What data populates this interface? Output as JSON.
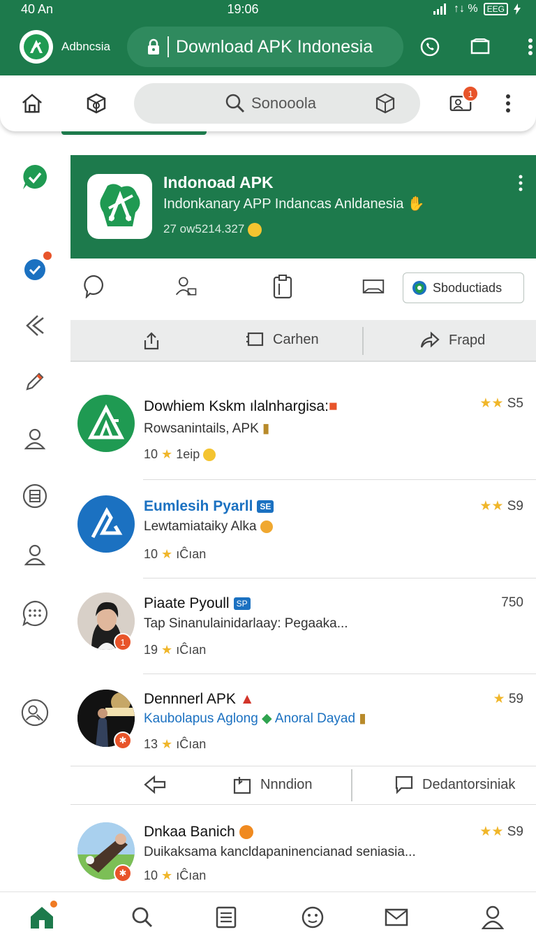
{
  "status_bar": {
    "time_left": "40 An",
    "clock": "19:06",
    "signal_text": "↑↓ %",
    "battery": "EEG"
  },
  "browser": {
    "site_name": "Adbncsia",
    "url": "Download APK Indonesia"
  },
  "toolbar": {
    "search_text": "Sonooola",
    "notification_count": "1"
  },
  "app_header": {
    "title": "Indonoad APK",
    "subtitle": "Indonkanary APP Indancas Anldanesia",
    "meta": "27 ow5214.327"
  },
  "action_row": {
    "badge_label": "Sboductiads"
  },
  "share_bar": {
    "share_label": "",
    "center_label": "Carhen",
    "forward_label": "Frapd"
  },
  "list": [
    {
      "title": "Dowhiem Kskm ılalnhargisa:",
      "subtitle": "Rowsanintails, APK",
      "meta_count": "10",
      "meta_text": "1eip",
      "rating": "S5",
      "tag": "",
      "badge": ""
    },
    {
      "title": "Eumlesih Pyarll",
      "subtitle": "Lewtamiataiky Alka",
      "meta_count": "10",
      "meta_text": "ıĈıan",
      "rating": "S9",
      "tag": "SE",
      "badge": ""
    },
    {
      "title": "Piaate Pyoull",
      "subtitle": "Tap  Sinanulainidarlaay: Pegaaka...",
      "meta_count": "19",
      "meta_text": "ıĈıan",
      "rating": "750",
      "tag": "SP",
      "badge": "1"
    },
    {
      "title": "Dennnerl APK",
      "subtitle": "Kaubolapus Aglong",
      "subtitle2": "Anoral Dayad",
      "meta_count": "13",
      "meta_text": "ıĈıan",
      "rating": "59",
      "tag": "",
      "badge": "✱"
    },
    {
      "title": "Dnkaa Banich",
      "subtitle": "Duikaksama kancldapaninencianad seniasia...",
      "meta_count": "10",
      "meta_text": "ıĈıan",
      "rating": "S9",
      "tag": "",
      "badge": "✱"
    }
  ],
  "inline_actions": {
    "center_label": "Nnndion",
    "right_label": "Dedantorsiniak"
  },
  "colors": {
    "brand_green": "#1d7a4c",
    "accent_blue": "#1b71c1",
    "star": "#f0b62a",
    "badge_orange": "#e8542a"
  },
  "icons": [
    "home-icon",
    "package-icon",
    "search-icon",
    "cube-icon",
    "profile-icon",
    "more-icon",
    "whatsapp-icon",
    "bookmark-icon",
    "lock-icon",
    "comment-icon",
    "user-icon",
    "clipboard-icon",
    "book-icon",
    "share-icon",
    "forward-icon"
  ]
}
